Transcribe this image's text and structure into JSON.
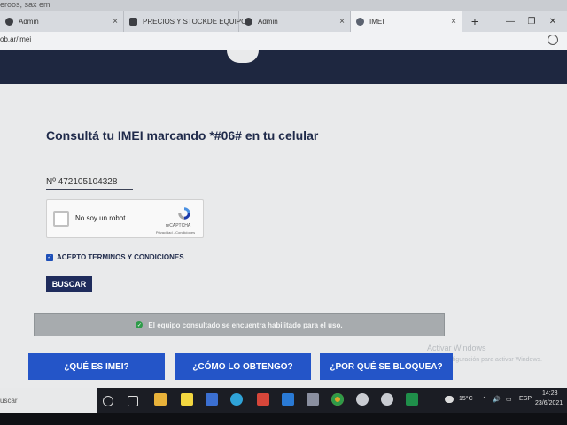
{
  "browser": {
    "top_sliver_text": "eroos, sax em",
    "tabs": [
      {
        "label": "Admin",
        "active": false
      },
      {
        "label": "PRECIOS Y STOCKDE EQUIPO",
        "active": false
      },
      {
        "label": "Admin",
        "active": false
      },
      {
        "label": "IMEI",
        "active": true
      }
    ],
    "new_tab": "+",
    "close_glyph": "×",
    "address": "ob.ar/imei"
  },
  "page": {
    "title": "Consultá tu IMEI marcando *#06# en tu celular",
    "imei_value": "Nº 472105104328",
    "captcha": {
      "label": "No soy un robot",
      "brand": "reCAPTCHA",
      "links": "Privacidad - Condiciones"
    },
    "terms_label": "ACEPTO TERMINOS Y CONDICIONES",
    "search_button": "BUSCAR",
    "status_message": "El equipo consultado se encuentra habilitado para el uso.",
    "info_buttons": [
      {
        "label": "¿QUÉ ES IMEI?"
      },
      {
        "label": "¿CÓMO LO OBTENGO?"
      },
      {
        "label": "¿POR QUÉ SE BLOQUEA?"
      }
    ],
    "watermark_line1": "Activar Windows",
    "watermark_line2": "Ve a Configuración para activar Windows."
  },
  "taskbar": {
    "search_text": "uscar",
    "temperature": "15°C",
    "language": "ESP",
    "time": "14:23",
    "date": "23/6/2021"
  },
  "colors": {
    "header_navy": "#1e2740",
    "button_blue": "#2455c8",
    "buscar_navy": "#1f2c5c",
    "title_navy": "#1f2a4a",
    "status_gray": "#a7abae",
    "success_green": "#2e9b49"
  }
}
